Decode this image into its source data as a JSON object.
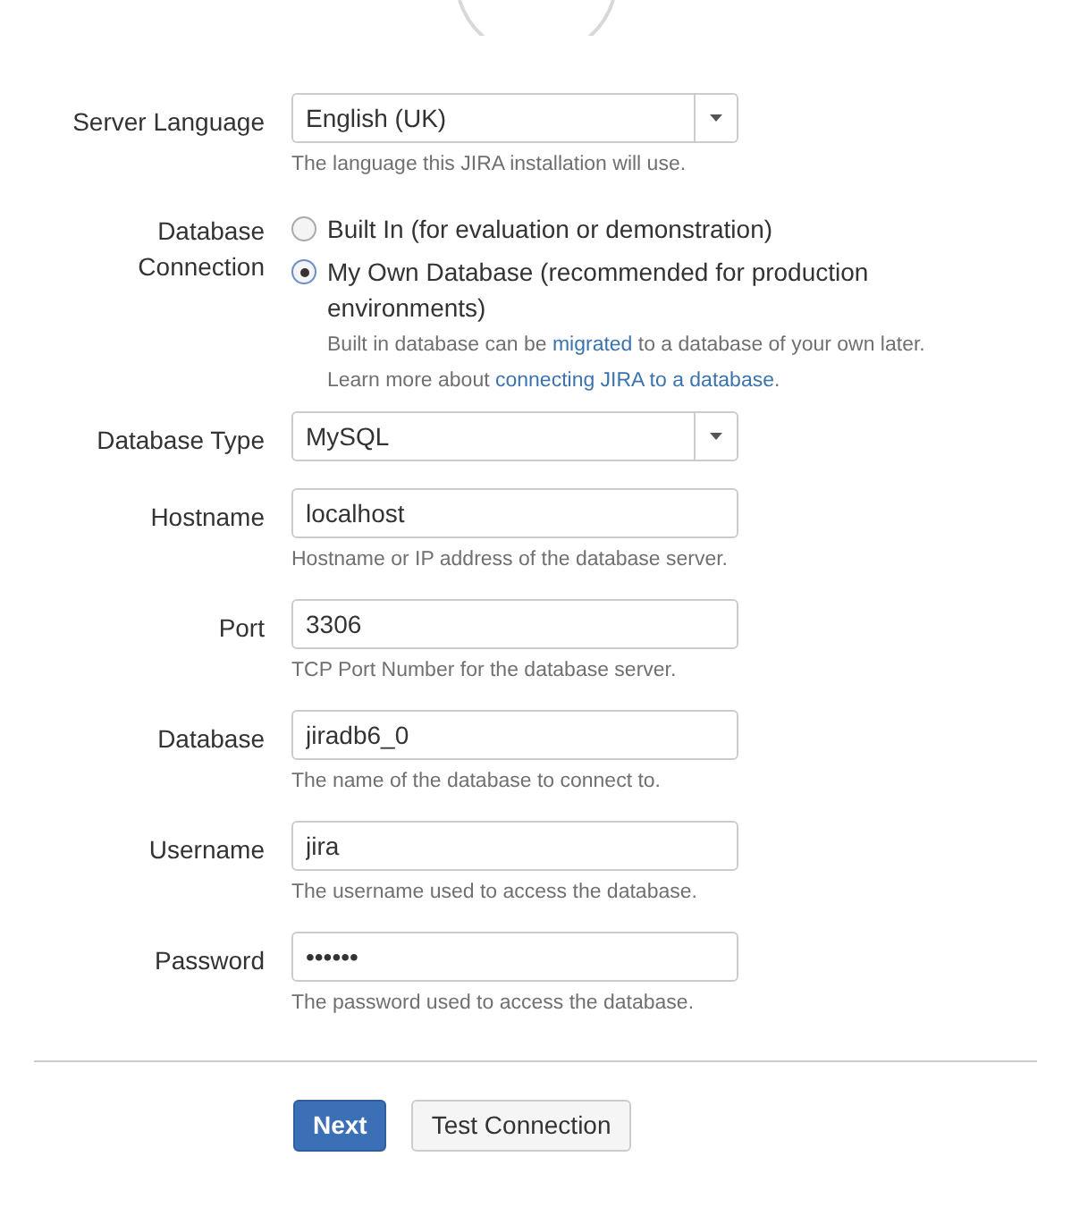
{
  "server_language": {
    "label": "Server Language",
    "value": "English (UK)",
    "help": "The language this JIRA installation will use."
  },
  "database_connection": {
    "label_lines": [
      "Database",
      "Connection"
    ],
    "options": [
      {
        "label": "Built In (for evaluation or demonstration)",
        "selected": false
      },
      {
        "label": "My Own Database (recommended for production environments)",
        "selected": true
      }
    ],
    "help_lines": [
      [
        {
          "kind": "text",
          "text": "Built in database can be "
        },
        {
          "kind": "link",
          "text": "migrated"
        },
        {
          "kind": "text",
          "text": " to a database of your own later."
        }
      ],
      [
        {
          "kind": "text",
          "text": "Learn more about "
        },
        {
          "kind": "link",
          "text": "connecting JIRA to a database"
        },
        {
          "kind": "text",
          "text": "."
        }
      ]
    ]
  },
  "database_type": {
    "label": "Database Type",
    "value": "MySQL"
  },
  "fields": [
    {
      "label": "Hostname",
      "value": "localhost",
      "help": "Hostname or IP address of the database server."
    },
    {
      "label": "Port",
      "value": "3306",
      "help": "TCP Port Number for the database server."
    },
    {
      "label": "Database",
      "value": "jiradb6_0",
      "help": "The name of the database to connect to."
    },
    {
      "label": "Username",
      "value": "jira",
      "help": "The username used to access the database."
    },
    {
      "label": "Password",
      "value": "••••••",
      "help": "The password used to access the database."
    }
  ],
  "buttons": [
    {
      "label": "Next",
      "kind": "primary"
    },
    {
      "label": "Test Connection",
      "kind": "secondary"
    }
  ]
}
